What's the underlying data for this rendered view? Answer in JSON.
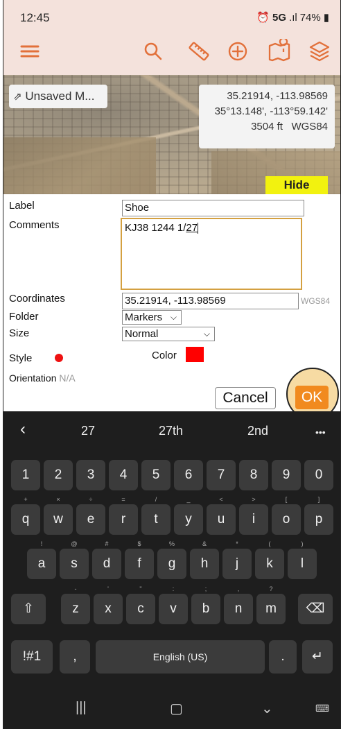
{
  "status_bar": {
    "time": "12:45",
    "network": "5G",
    "signal": ".ıl",
    "battery": "74%"
  },
  "map": {
    "unsaved_label": "Unsaved M...",
    "coord_decimal": "35.21914, -113.98569",
    "coord_dm": "35°13.148', -113°59.142'",
    "elevation": "3504 ft",
    "datum": "WGS84",
    "hide_label": "Hide"
  },
  "form": {
    "label_caption": "Label",
    "label_value": "Shoe",
    "comments_caption": "Comments",
    "comments_value_prefix": "KJ38 1244 1/",
    "comments_value_underlined": "27",
    "coordinates_caption": "Coordinates",
    "coordinates_value": "35.21914, -113.98569",
    "coordinates_datum": "WGS84",
    "folder_caption": "Folder",
    "folder_value": "Markers",
    "size_caption": "Size",
    "size_value": "Normal",
    "style_caption": "Style",
    "color_caption": "Color",
    "orientation_caption": "Orientation",
    "orientation_value": "N/A",
    "cancel_label": "Cancel",
    "ok_label": "OK"
  },
  "colors": {
    "accent": "#e2703a",
    "ok": "#f18a1f",
    "hide": "#f2f20f",
    "marker": "#ff0000"
  },
  "keyboard": {
    "suggestions": [
      "27",
      "27th",
      "2nd"
    ],
    "more": "•••",
    "numbers": [
      "1",
      "2",
      "3",
      "4",
      "5",
      "6",
      "7",
      "8",
      "9",
      "0"
    ],
    "row1": [
      "q",
      "w",
      "e",
      "r",
      "t",
      "y",
      "u",
      "i",
      "o",
      "p"
    ],
    "row1_hints": [
      "+",
      "×",
      "÷",
      "=",
      "/",
      "_",
      "<",
      ">",
      "[",
      "]"
    ],
    "row2": [
      "a",
      "s",
      "d",
      "f",
      "g",
      "h",
      "j",
      "k",
      "l"
    ],
    "row2_hints": [
      "!",
      "@",
      "#",
      "$",
      "%",
      "&",
      "*",
      "(",
      ")"
    ],
    "row3": [
      "z",
      "x",
      "c",
      "v",
      "b",
      "n",
      "m"
    ],
    "row3_hints": [
      "-",
      "'",
      "\"",
      ":",
      ";",
      ",",
      "?"
    ],
    "symbols_label": "!#1",
    "comma": ",",
    "space_label": "English (US)",
    "period": "."
  },
  "icons": [
    "menu-icon",
    "search-icon",
    "ruler-icon",
    "add-circle-icon",
    "map-pin-icon",
    "layers-icon"
  ]
}
